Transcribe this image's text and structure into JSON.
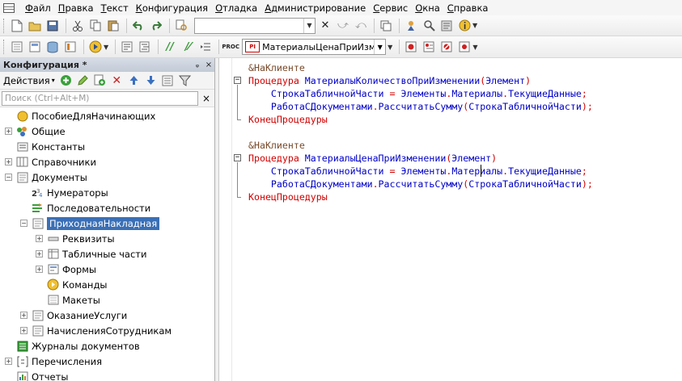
{
  "menu": {
    "items": [
      {
        "id": "file",
        "label": "Файл"
      },
      {
        "id": "edit",
        "label": "Правка"
      },
      {
        "id": "text",
        "label": "Текст"
      },
      {
        "id": "config",
        "label": "Конфигурация"
      },
      {
        "id": "debug",
        "label": "Отладка"
      },
      {
        "id": "admin",
        "label": "Администрирование"
      },
      {
        "id": "service",
        "label": "Сервис"
      },
      {
        "id": "windows",
        "label": "Окна"
      },
      {
        "id": "help",
        "label": "Справка"
      }
    ]
  },
  "toolbar": {
    "search_value": "",
    "procedure_value": "МатериалыЦенаПриИзменении",
    "procedure_badge": "PI"
  },
  "left_panel": {
    "title": "Конфигурация *",
    "pin_glyph": "ᵩ",
    "close_glyph": "×",
    "actions_label": "Действия",
    "actions_arrow": "▾",
    "filter_placeholder": "Поиск (Ctrl+Alt+M)",
    "filter_clear": "×",
    "tree": [
      {
        "label": "ПособиеДляНачинающих",
        "expander": "",
        "icon": "root-circle-icon",
        "selected": false
      },
      {
        "label": "Общие",
        "expander": "+",
        "icon": "common-icon",
        "selected": false
      },
      {
        "label": "Константы",
        "expander": "",
        "icon": "constants-icon",
        "selected": false
      },
      {
        "label": "Справочники",
        "expander": "+",
        "icon": "catalogs-icon",
        "selected": false
      },
      {
        "label": "Документы",
        "expander": "−",
        "icon": "documents-icon",
        "selected": false
      },
      {
        "label": "Нумераторы",
        "expander": "",
        "icon": "numerators-icon",
        "selected": false
      },
      {
        "label": "Последовательности",
        "expander": "",
        "icon": "sequences-icon",
        "selected": false
      },
      {
        "label": "ПриходнаяНакладная",
        "expander": "−",
        "icon": "document-icon",
        "selected": true
      },
      {
        "label": "Реквизиты",
        "expander": "+",
        "icon": "attributes-icon",
        "selected": false
      },
      {
        "label": "Табличные части",
        "expander": "+",
        "icon": "tabular-sections-icon",
        "selected": false
      },
      {
        "label": "Формы",
        "expander": "+",
        "icon": "forms-icon",
        "selected": false
      },
      {
        "label": "Команды",
        "expander": "",
        "icon": "commands-icon",
        "selected": false
      },
      {
        "label": "Макеты",
        "expander": "",
        "icon": "templates-icon",
        "selected": false
      },
      {
        "label": "ОказаниеУслуги",
        "expander": "+",
        "icon": "document-icon",
        "selected": false
      },
      {
        "label": "НачисленияСотрудникам",
        "expander": "+",
        "icon": "document-icon",
        "selected": false
      },
      {
        "label": "Журналы документов",
        "expander": "",
        "icon": "journals-icon",
        "selected": false
      },
      {
        "label": "Перечисления",
        "expander": "+",
        "icon": "enums-icon",
        "selected": false
      },
      {
        "label": "Отчеты",
        "expander": "",
        "icon": "reports-icon",
        "selected": false
      }
    ]
  },
  "editor": {
    "lines": [
      {
        "segments": [
          {
            "t": "&НаКлиенте",
            "c": "pre"
          }
        ]
      },
      {
        "segments": [
          {
            "t": "Процедура",
            "c": "kw"
          },
          {
            "t": " МатериалыКоличествоПриИзменении",
            "c": "id"
          },
          {
            "t": "(",
            "c": "op"
          },
          {
            "t": "Элемент",
            "c": "id"
          },
          {
            "t": ")",
            "c": "op"
          }
        ]
      },
      {
        "segments": [
          {
            "t": "    СтрокаТабличнойЧасти ",
            "c": "id"
          },
          {
            "t": "=",
            "c": "op"
          },
          {
            "t": " Элементы",
            "c": "id"
          },
          {
            "t": ".",
            "c": "op"
          },
          {
            "t": "Материалы",
            "c": "id"
          },
          {
            "t": ".",
            "c": "op"
          },
          {
            "t": "ТекущиеДанные",
            "c": "id"
          },
          {
            "t": ";",
            "c": "op"
          }
        ]
      },
      {
        "segments": [
          {
            "t": "    РаботаСДокументами",
            "c": "id"
          },
          {
            "t": ".",
            "c": "op"
          },
          {
            "t": "РассчитатьСумму",
            "c": "id"
          },
          {
            "t": "(",
            "c": "op"
          },
          {
            "t": "СтрокаТабличнойЧасти",
            "c": "id"
          },
          {
            "t": ");",
            "c": "op"
          }
        ]
      },
      {
        "segments": [
          {
            "t": "КонецПроцедуры",
            "c": "kw"
          }
        ]
      },
      {
        "segments": [
          {
            "t": "",
            "c": "id"
          }
        ]
      },
      {
        "segments": [
          {
            "t": "&НаКлиенте",
            "c": "pre"
          }
        ]
      },
      {
        "segments": [
          {
            "t": "Процедура",
            "c": "kw"
          },
          {
            "t": " МатериалыЦенаПриИзменении",
            "c": "id"
          },
          {
            "t": "(",
            "c": "op"
          },
          {
            "t": "Элемент",
            "c": "id"
          },
          {
            "t": ")",
            "c": "op"
          }
        ]
      },
      {
        "segments": [
          {
            "t": "    СтрокаТабличнойЧасти ",
            "c": "id"
          },
          {
            "t": "=",
            "c": "op"
          },
          {
            "t": " Элементы",
            "c": "id"
          },
          {
            "t": ".",
            "c": "op"
          },
          {
            "t": "Материалы",
            "c": "id"
          },
          {
            "t": ".",
            "c": "op"
          },
          {
            "t": "ТекущиеДанные",
            "c": "id"
          },
          {
            "t": ";",
            "c": "op"
          }
        ]
      },
      {
        "segments": [
          {
            "t": "    РаботаСДокументами",
            "c": "id"
          },
          {
            "t": ".",
            "c": "op"
          },
          {
            "t": "РассчитатьСумму",
            "c": "id"
          },
          {
            "t": "(",
            "c": "op"
          },
          {
            "t": "СтрокаТабличнойЧасти",
            "c": "id"
          },
          {
            "t": ");",
            "c": "op"
          }
        ]
      },
      {
        "segments": [
          {
            "t": "КонецПроцедуры",
            "c": "kw"
          }
        ]
      }
    ]
  }
}
